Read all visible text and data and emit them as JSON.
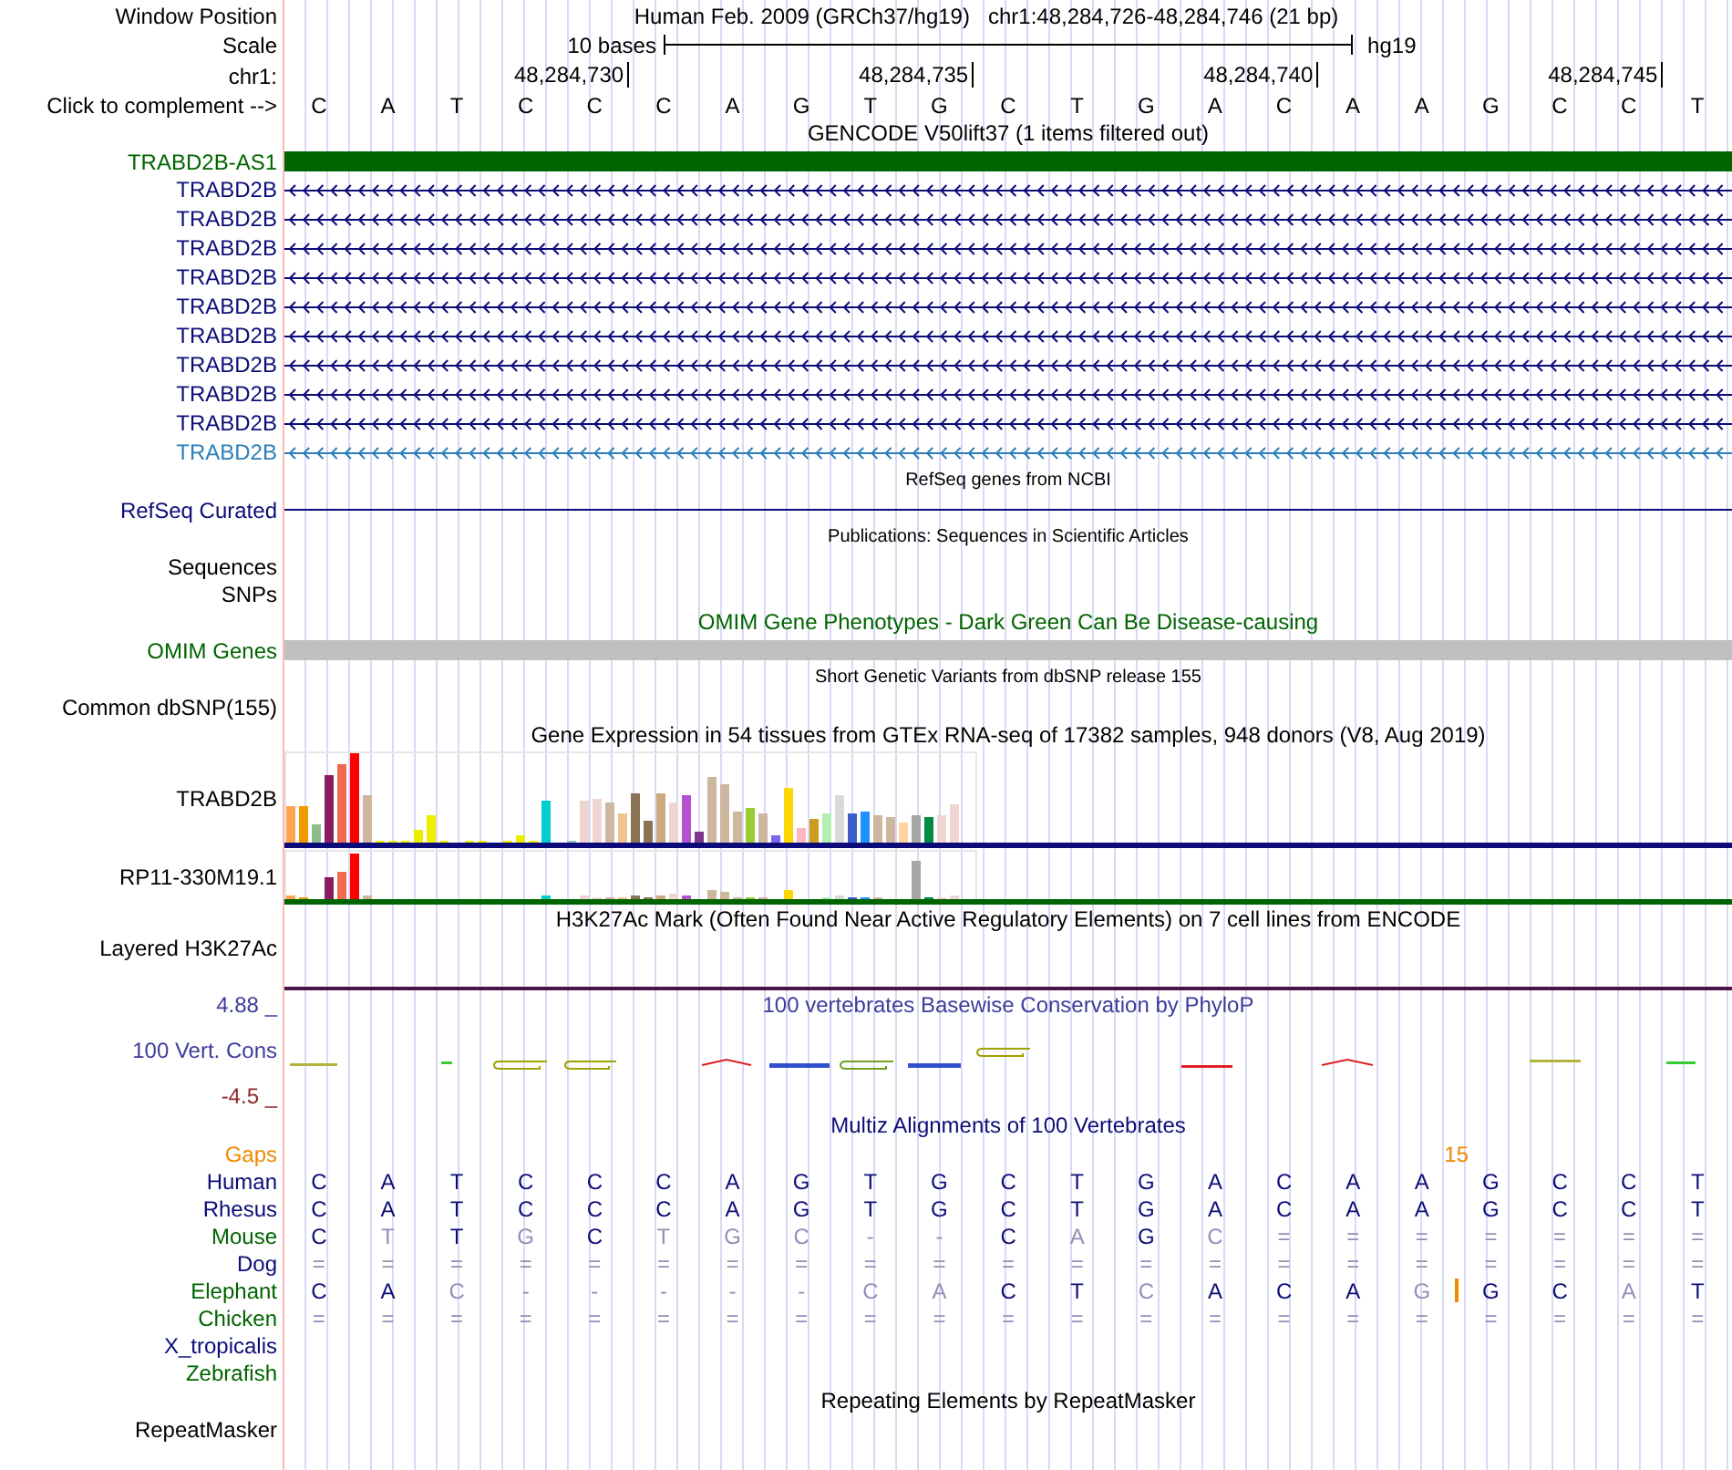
{
  "header": {
    "position": {
      "label": "Window Position",
      "assembly": "Human Feb. 2009 (GRCh37/hg19)",
      "range": "chr1:48,284,726-48,284,746 (21 bp)"
    },
    "scale": {
      "label": "Scale",
      "length": "10 bases",
      "assembly": "hg19"
    },
    "ruler": {
      "label": "chr1:",
      "ticks": [
        "48,284,730",
        "48,284,735",
        "48,284,740",
        "48,284,745"
      ]
    },
    "sequence": {
      "label": "Click to complement -->",
      "bases": [
        "C",
        "A",
        "T",
        "C",
        "C",
        "C",
        "A",
        "G",
        "T",
        "G",
        "C",
        "T",
        "G",
        "A",
        "C",
        "A",
        "A",
        "G",
        "C",
        "C",
        "T"
      ]
    }
  },
  "tracks": [
    {
      "kind": "features",
      "dense": false,
      "title": {
        "text": "GENCODE V50lift37 (1 items filtered out)",
        "color": "#000000"
      },
      "features": [
        {
          "kind": "block",
          "label": {
            "text": "TRABD2B-AS1",
            "color": "#006400"
          },
          "color": "#006400"
        },
        {
          "kind": "intron",
          "label": {
            "text": "TRABD2B",
            "color": "#0c0c78"
          },
          "color": "#0c0c78"
        },
        {
          "kind": "intron",
          "label": {
            "text": "TRABD2B",
            "color": "#0c0c78"
          },
          "color": "#0c0c78"
        },
        {
          "kind": "intron",
          "label": {
            "text": "TRABD2B",
            "color": "#0c0c78"
          },
          "color": "#0c0c78"
        },
        {
          "kind": "intron",
          "label": {
            "text": "TRABD2B",
            "color": "#0c0c78"
          },
          "color": "#0c0c78"
        },
        {
          "kind": "intron",
          "label": {
            "text": "TRABD2B",
            "color": "#0c0c78"
          },
          "color": "#0c0c78"
        },
        {
          "kind": "intron",
          "label": {
            "text": "TRABD2B",
            "color": "#0c0c78"
          },
          "color": "#0c0c78"
        },
        {
          "kind": "intron",
          "label": {
            "text": "TRABD2B",
            "color": "#0c0c78"
          },
          "color": "#0c0c78"
        },
        {
          "kind": "intron",
          "label": {
            "text": "TRABD2B",
            "color": "#0c0c78"
          },
          "color": "#0c0c78"
        },
        {
          "kind": "intron",
          "label": {
            "text": "TRABD2B",
            "color": "#0c0c78"
          },
          "color": "#0c0c78"
        },
        {
          "kind": "intron",
          "label": {
            "text": "TRABD2B",
            "color": "#2b7fb8"
          },
          "color": "#2b7fb8"
        }
      ]
    },
    {
      "kind": "features",
      "dense": true,
      "title": {
        "text": "RefSeq genes from NCBI",
        "color": "#000000"
      },
      "features": [
        {
          "kind": "line",
          "label": {
            "text": "RefSeq Curated",
            "color": "#0c0c78"
          },
          "color": "#0c0c78"
        }
      ]
    },
    {
      "kind": "features",
      "dense": true,
      "title": {
        "text": "Publications: Sequences in Scientific Articles",
        "color": "#000000"
      },
      "features": [
        {
          "kind": "empty",
          "label": {
            "text": "Sequences",
            "color": "#000000"
          }
        },
        {
          "kind": "empty",
          "label": {
            "text": "SNPs",
            "color": "#000000"
          }
        }
      ]
    },
    {
      "kind": "features",
      "dense": false,
      "title": {
        "text": "OMIM Gene Phenotypes - Dark Green Can Be Disease-causing",
        "color": "#006400"
      },
      "features": [
        {
          "kind": "block",
          "label": {
            "text": "OMIM Genes",
            "color": "#006400"
          },
          "color": "#c0c0c0"
        }
      ]
    },
    {
      "kind": "features",
      "dense": true,
      "title": {
        "text": "Short Genetic Variants from dbSNP release 155",
        "color": "#000000"
      },
      "features": [
        {
          "kind": "empty",
          "label": {
            "text": "Common dbSNP(155)",
            "color": "#000000"
          }
        }
      ]
    },
    {
      "kind": "features",
      "dense": false,
      "title": {
        "text": "Gene Expression in 54 tissues from GTEx RNA-seq of 17382 samples, 948 donors (V8, Aug 2019)",
        "color": "#000000"
      },
      "features": [
        {
          "kind": "expression",
          "label": {
            "text": "TRABD2B",
            "color": "#000000"
          },
          "color": "#0c0c78"
        },
        {
          "kind": "expression",
          "label": {
            "text": "RP11-330M19.1",
            "color": "#000000"
          },
          "color": "#006400"
        }
      ]
    },
    {
      "kind": "features",
      "dense": false,
      "title": {
        "text": "H3K27Ac Mark (Often Found Near Active Regulatory Elements) on 7 cell lines from ENCODE",
        "color": "#000000"
      },
      "features": [
        {
          "kind": "signal",
          "label": {
            "text": "Layered H3K27Ac",
            "color": "#000000"
          },
          "color": "#4a154a"
        }
      ]
    },
    {
      "kind": "conservation",
      "dense": false,
      "title": {
        "text": "100 vertebrates Basewise Conservation by PhyloP",
        "color": "#3c3c9c"
      },
      "label": {
        "text": "100 Vert. Cons",
        "color": "#3c3c9c"
      },
      "axis_max": {
        "text": "4.88 _",
        "color": "#3c3c9c"
      },
      "axis_min": {
        "text": "-4.5 _",
        "color": "#8b2a2a"
      }
    },
    {
      "kind": "alignment",
      "dense": false,
      "title": {
        "text": "Multiz Alignments of 100 Vertebrates",
        "color": "#0c0c78"
      },
      "gaps": {
        "text": "Gaps",
        "color": "#ee8a00"
      },
      "species": [
        {
          "label": {
            "text": "Human",
            "color": "#0c0c78"
          },
          "bases": [
            {
              "kind": "base",
              "text": "C",
              "match": true
            },
            {
              "kind": "base",
              "text": "A",
              "match": true
            },
            {
              "kind": "base",
              "text": "T",
              "match": true
            },
            {
              "kind": "base",
              "text": "C",
              "match": true
            },
            {
              "kind": "base",
              "text": "C",
              "match": true
            },
            {
              "kind": "base",
              "text": "C",
              "match": true
            },
            {
              "kind": "base",
              "text": "A",
              "match": true
            },
            {
              "kind": "base",
              "text": "G",
              "match": true
            },
            {
              "kind": "base",
              "text": "T",
              "match": true
            },
            {
              "kind": "base",
              "text": "G",
              "match": true
            },
            {
              "kind": "base",
              "text": "C",
              "match": true
            },
            {
              "kind": "base",
              "text": "T",
              "match": true
            },
            {
              "kind": "base",
              "text": "G",
              "match": true
            },
            {
              "kind": "base",
              "text": "A",
              "match": true
            },
            {
              "kind": "base",
              "text": "C",
              "match": true
            },
            {
              "kind": "base",
              "text": "A",
              "match": true
            },
            {
              "kind": "base",
              "text": "A",
              "match": true
            },
            {
              "kind": "base",
              "text": "G",
              "match": true
            },
            {
              "kind": "base",
              "text": "C",
              "match": true
            },
            {
              "kind": "base",
              "text": "C",
              "match": true
            },
            {
              "kind": "base",
              "text": "T",
              "match": true
            }
          ]
        },
        {
          "label": {
            "text": "Rhesus",
            "color": "#0c0c78"
          },
          "bases": [
            {
              "kind": "base",
              "text": "C",
              "match": true
            },
            {
              "kind": "base",
              "text": "A",
              "match": true
            },
            {
              "kind": "base",
              "text": "T",
              "match": true
            },
            {
              "kind": "base",
              "text": "C",
              "match": true
            },
            {
              "kind": "base",
              "text": "C",
              "match": true
            },
            {
              "kind": "base",
              "text": "C",
              "match": true
            },
            {
              "kind": "base",
              "text": "A",
              "match": true
            },
            {
              "kind": "base",
              "text": "G",
              "match": true
            },
            {
              "kind": "base",
              "text": "T",
              "match": true
            },
            {
              "kind": "base",
              "text": "G",
              "match": true
            },
            {
              "kind": "base",
              "text": "C",
              "match": true
            },
            {
              "kind": "base",
              "text": "T",
              "match": true
            },
            {
              "kind": "base",
              "text": "G",
              "match": true
            },
            {
              "kind": "base",
              "text": "A",
              "match": true
            },
            {
              "kind": "base",
              "text": "C",
              "match": true
            },
            {
              "kind": "base",
              "text": "A",
              "match": true
            },
            {
              "kind": "base",
              "text": "A",
              "match": true
            },
            {
              "kind": "base",
              "text": "G",
              "match": true
            },
            {
              "kind": "base",
              "text": "C",
              "match": true
            },
            {
              "kind": "base",
              "text": "C",
              "match": true
            },
            {
              "kind": "base",
              "text": "T",
              "match": true
            }
          ]
        },
        {
          "label": {
            "text": "Mouse",
            "color": "#006400"
          },
          "bases": [
            {
              "kind": "base",
              "text": "C",
              "match": true
            },
            {
              "kind": "base",
              "text": "T",
              "match": false
            },
            {
              "kind": "base",
              "text": "T",
              "match": true
            },
            {
              "kind": "base",
              "text": "G",
              "match": false
            },
            {
              "kind": "base",
              "text": "C",
              "match": true
            },
            {
              "kind": "base",
              "text": "T",
              "match": false
            },
            {
              "kind": "base",
              "text": "G",
              "match": false
            },
            {
              "kind": "base",
              "text": "C",
              "match": false
            },
            {
              "kind": "base",
              "text": "-",
              "match": false
            },
            {
              "kind": "base",
              "text": "-",
              "match": false
            },
            {
              "kind": "base",
              "text": "C",
              "match": true
            },
            {
              "kind": "base",
              "text": "A",
              "match": false
            },
            {
              "kind": "base",
              "text": "G",
              "match": true
            },
            {
              "kind": "base",
              "text": "C",
              "match": false
            },
            {
              "kind": "base",
              "text": "=",
              "match": false
            },
            {
              "kind": "base",
              "text": "=",
              "match": false
            },
            {
              "kind": "base",
              "text": "=",
              "match": false
            },
            {
              "kind": "base",
              "text": "=",
              "match": false
            },
            {
              "kind": "base",
              "text": "=",
              "match": false
            },
            {
              "kind": "base",
              "text": "=",
              "match": false
            },
            {
              "kind": "base",
              "text": "=",
              "match": false
            }
          ]
        },
        {
          "label": {
            "text": "Dog",
            "color": "#0c0c78"
          },
          "bases": [
            {
              "kind": "base",
              "text": "=",
              "match": false
            },
            {
              "kind": "base",
              "text": "=",
              "match": false
            },
            {
              "kind": "base",
              "text": "=",
              "match": false
            },
            {
              "kind": "base",
              "text": "=",
              "match": false
            },
            {
              "kind": "base",
              "text": "=",
              "match": false
            },
            {
              "kind": "base",
              "text": "=",
              "match": false
            },
            {
              "kind": "base",
              "text": "=",
              "match": false
            },
            {
              "kind": "base",
              "text": "=",
              "match": false
            },
            {
              "kind": "base",
              "text": "=",
              "match": false
            },
            {
              "kind": "base",
              "text": "=",
              "match": false
            },
            {
              "kind": "base",
              "text": "=",
              "match": false
            },
            {
              "kind": "base",
              "text": "=",
              "match": false
            },
            {
              "kind": "base",
              "text": "=",
              "match": false
            },
            {
              "kind": "base",
              "text": "=",
              "match": false
            },
            {
              "kind": "base",
              "text": "=",
              "match": false
            },
            {
              "kind": "base",
              "text": "=",
              "match": false
            },
            {
              "kind": "base",
              "text": "=",
              "match": false
            },
            {
              "kind": "base",
              "text": "=",
              "match": false
            },
            {
              "kind": "base",
              "text": "=",
              "match": false
            },
            {
              "kind": "base",
              "text": "=",
              "match": false
            },
            {
              "kind": "base",
              "text": "=",
              "match": false
            }
          ]
        },
        {
          "label": {
            "text": "Elephant",
            "color": "#006400"
          },
          "bases": [
            {
              "kind": "base",
              "text": "C",
              "match": true
            },
            {
              "kind": "base",
              "text": "A",
              "match": true
            },
            {
              "kind": "base",
              "text": "C",
              "match": false
            },
            {
              "kind": "base",
              "text": "-",
              "match": false
            },
            {
              "kind": "base",
              "text": "-",
              "match": false
            },
            {
              "kind": "base",
              "text": "-",
              "match": false
            },
            {
              "kind": "base",
              "text": "-",
              "match": false
            },
            {
              "kind": "base",
              "text": "-",
              "match": false
            },
            {
              "kind": "base",
              "text": "C",
              "match": false
            },
            {
              "kind": "base",
              "text": "A",
              "match": false
            },
            {
              "kind": "base",
              "text": "C",
              "match": true
            },
            {
              "kind": "base",
              "text": "T",
              "match": true
            },
            {
              "kind": "base",
              "text": "C",
              "match": false
            },
            {
              "kind": "base",
              "text": "A",
              "match": true
            },
            {
              "kind": "base",
              "text": "C",
              "match": true
            },
            {
              "kind": "base",
              "text": "A",
              "match": true
            },
            {
              "kind": "base",
              "text": "G",
              "match": false
            },
            {
              "kind": "insertion",
              "count": "15"
            },
            {
              "kind": "base",
              "text": "G",
              "match": true
            },
            {
              "kind": "base",
              "text": "C",
              "match": true
            },
            {
              "kind": "base",
              "text": "A",
              "match": false
            },
            {
              "kind": "base",
              "text": "T",
              "match": true
            }
          ]
        },
        {
          "label": {
            "text": "Chicken",
            "color": "#006400"
          },
          "bases": [
            {
              "kind": "base",
              "text": "=",
              "match": false
            },
            {
              "kind": "base",
              "text": "=",
              "match": false
            },
            {
              "kind": "base",
              "text": "=",
              "match": false
            },
            {
              "kind": "base",
              "text": "=",
              "match": false
            },
            {
              "kind": "base",
              "text": "=",
              "match": false
            },
            {
              "kind": "base",
              "text": "=",
              "match": false
            },
            {
              "kind": "base",
              "text": "=",
              "match": false
            },
            {
              "kind": "base",
              "text": "=",
              "match": false
            },
            {
              "kind": "base",
              "text": "=",
              "match": false
            },
            {
              "kind": "base",
              "text": "=",
              "match": false
            },
            {
              "kind": "base",
              "text": "=",
              "match": false
            },
            {
              "kind": "base",
              "text": "=",
              "match": false
            },
            {
              "kind": "base",
              "text": "=",
              "match": false
            },
            {
              "kind": "base",
              "text": "=",
              "match": false
            },
            {
              "kind": "base",
              "text": "=",
              "match": false
            },
            {
              "kind": "base",
              "text": "=",
              "match": false
            },
            {
              "kind": "base",
              "text": "=",
              "match": false
            },
            {
              "kind": "base",
              "text": "=",
              "match": false
            },
            {
              "kind": "base",
              "text": "=",
              "match": false
            },
            {
              "kind": "base",
              "text": "=",
              "match": false
            },
            {
              "kind": "base",
              "text": "=",
              "match": false
            }
          ]
        },
        {
          "label": {
            "text": "X_tropicalis",
            "color": "#0c0c78"
          }
        },
        {
          "label": {
            "text": "Zebrafish",
            "color": "#006400"
          }
        }
      ]
    },
    {
      "kind": "features",
      "dense": false,
      "title": {
        "text": "Repeating Elements by RepeatMasker",
        "color": "#000000"
      },
      "features": [
        {
          "kind": "empty",
          "label": {
            "text": "RepeatMasker",
            "color": "#000000"
          }
        }
      ]
    }
  ]
}
